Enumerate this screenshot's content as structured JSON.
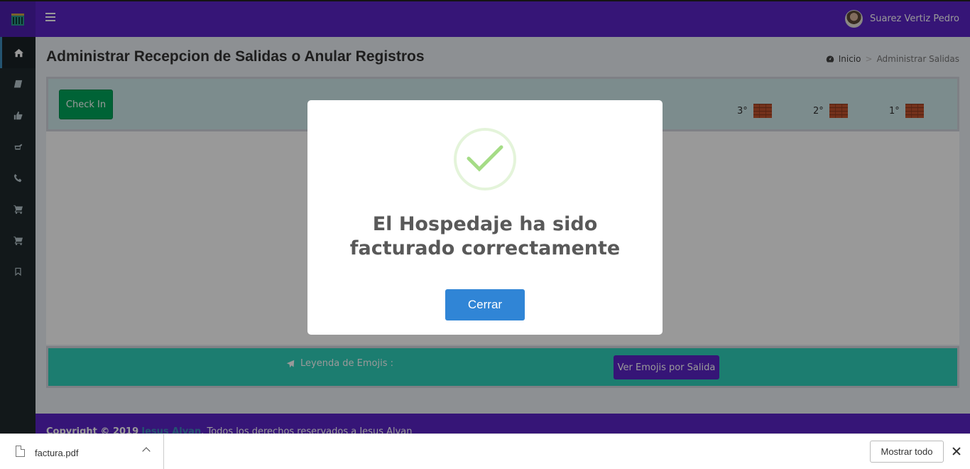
{
  "header": {
    "user_name": "Suarez Vertiz Pedro",
    "logo_icon": "hotel-building-icon",
    "menu_icon": "hamburger-icon"
  },
  "sidebar": {
    "items": [
      {
        "icon": "home-icon",
        "active": true
      },
      {
        "icon": "book-icon"
      },
      {
        "icon": "thumbs-up-icon"
      },
      {
        "icon": "hand-point-icon"
      },
      {
        "icon": "phone-icon"
      },
      {
        "icon": "cart-icon"
      },
      {
        "icon": "cart-icon"
      },
      {
        "icon": "bookmark-icon"
      }
    ]
  },
  "page": {
    "title": "Administrar Recepcion de Salidas o Anular Registros",
    "breadcrumb": {
      "home": "Inicio",
      "current": "Administrar Salidas"
    },
    "checkin_label": "Check In",
    "floors": [
      "3°",
      "2°",
      "1°"
    ],
    "legend_label": "Leyenda de Emojis :",
    "emojis_button": "Ver Emojis por Salida"
  },
  "footer": {
    "prefix": "Copyright © 2019",
    "author": "Jesus Alvan",
    "suffix": ". Todos los derechos reservados a Jesus Alvan"
  },
  "modal": {
    "title": "El Hospedaje ha sido facturado correctamente",
    "close_label": "Cerrar"
  },
  "downloads": {
    "file_name": "factura.pdf",
    "show_all": "Mostrar todo"
  },
  "colors": {
    "primary": "#5a24c7",
    "success": "#00a65a",
    "teal": "#2fd0bb",
    "confirm": "#3085d6"
  }
}
